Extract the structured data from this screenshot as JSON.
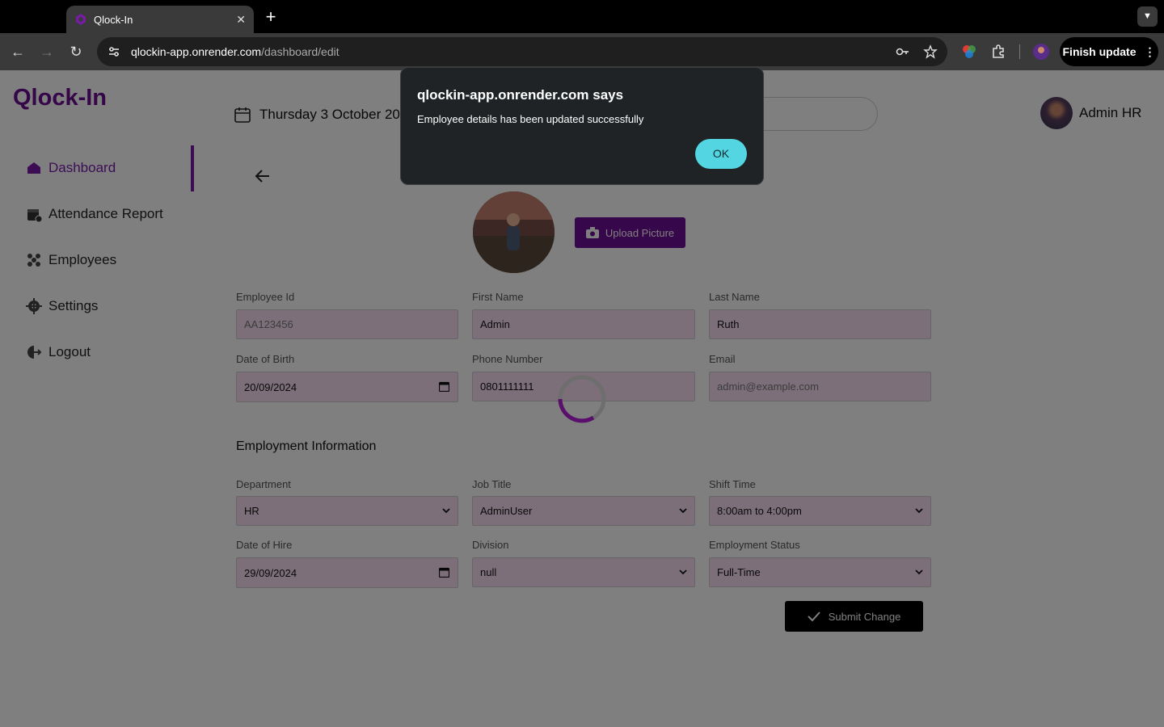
{
  "browser": {
    "tab_title": "Qlock-In",
    "url_host": "qlockin-app.onrender.com",
    "url_path": "/dashboard/edit",
    "finish_update_label": "Finish update"
  },
  "app": {
    "logo": "Qlock-In",
    "date": "Thursday 3 October 202",
    "user_name": "Admin HR"
  },
  "sidebar": {
    "items": [
      {
        "label": "Dashboard",
        "icon": "home-icon",
        "active": true
      },
      {
        "label": "Attendance Report",
        "icon": "calendar-check-icon"
      },
      {
        "label": "Employees",
        "icon": "people-icon"
      },
      {
        "label": "Settings",
        "icon": "gear-icon"
      },
      {
        "label": "Logout",
        "icon": "logout-icon"
      }
    ]
  },
  "form": {
    "upload_label": "Upload Picture",
    "employee_id": {
      "label": "Employee Id",
      "value": "AA123456"
    },
    "first_name": {
      "label": "First Name",
      "value": "Admin"
    },
    "last_name": {
      "label": "Last Name",
      "value": "Ruth"
    },
    "dob": {
      "label": "Date of Birth",
      "value": "20/09/2024"
    },
    "phone": {
      "label": "Phone Number",
      "value": "0801111111"
    },
    "email": {
      "label": "Email",
      "value": "admin@example.com"
    },
    "section_title": "Employment Information",
    "department": {
      "label": "Department",
      "value": "HR"
    },
    "job_title": {
      "label": "Job Title",
      "value": "AdminUser"
    },
    "shift_time": {
      "label": "Shift Time",
      "value": "8:00am to 4:00pm"
    },
    "date_of_hire": {
      "label": "Date of Hire",
      "value": "29/09/2024"
    },
    "division": {
      "label": "Division",
      "value": "null"
    },
    "employment_status": {
      "label": "Employment Status",
      "value": "Full-Time"
    },
    "submit_label": "Submit Change"
  },
  "dialog": {
    "title": "qlockin-app.onrender.com says",
    "message": "Employee details has been updated successfully",
    "ok_label": "OK"
  },
  "colors": {
    "brand": "#6a0d91",
    "field_bg": "#f8dff3",
    "dialog_button": "#53d6e1"
  }
}
